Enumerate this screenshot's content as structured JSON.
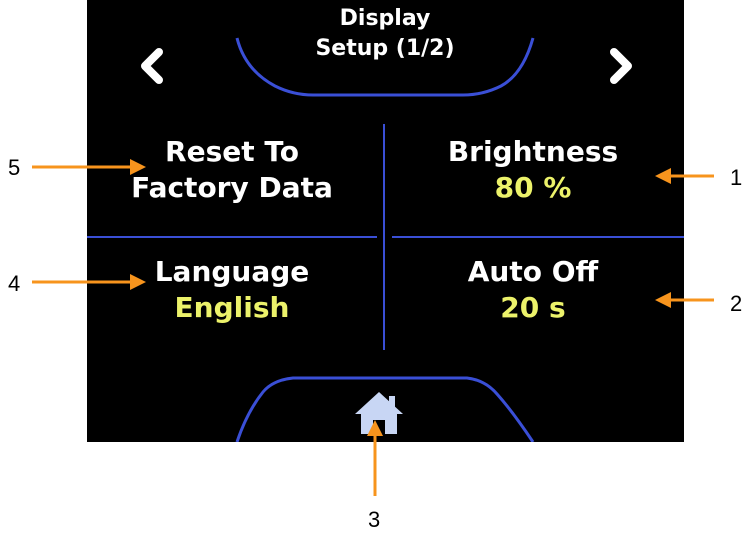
{
  "header": {
    "title_line1": "Display",
    "title_line2": "Setup (1/2)",
    "prev_icon": "chevron-left-icon",
    "next_icon": "chevron-right-icon"
  },
  "tiles": {
    "reset": {
      "line1": "Reset To",
      "line2": "Factory Data"
    },
    "brightness": {
      "label": "Brightness",
      "value": "80 %"
    },
    "language": {
      "label": "Language",
      "value": "English"
    },
    "auto_off": {
      "label": "Auto Off",
      "value": "20 s"
    }
  },
  "footer": {
    "home_icon": "home-icon"
  },
  "callouts": {
    "c1": "1",
    "c2": "2",
    "c3": "3",
    "c4": "4",
    "c5": "5"
  },
  "colors": {
    "screen_bg": "#000000",
    "divider": "#3a4fd6",
    "label": "#ffffff",
    "value": "#ecf26a",
    "arrow": "#f7941d",
    "home": "#c8d6f4"
  }
}
